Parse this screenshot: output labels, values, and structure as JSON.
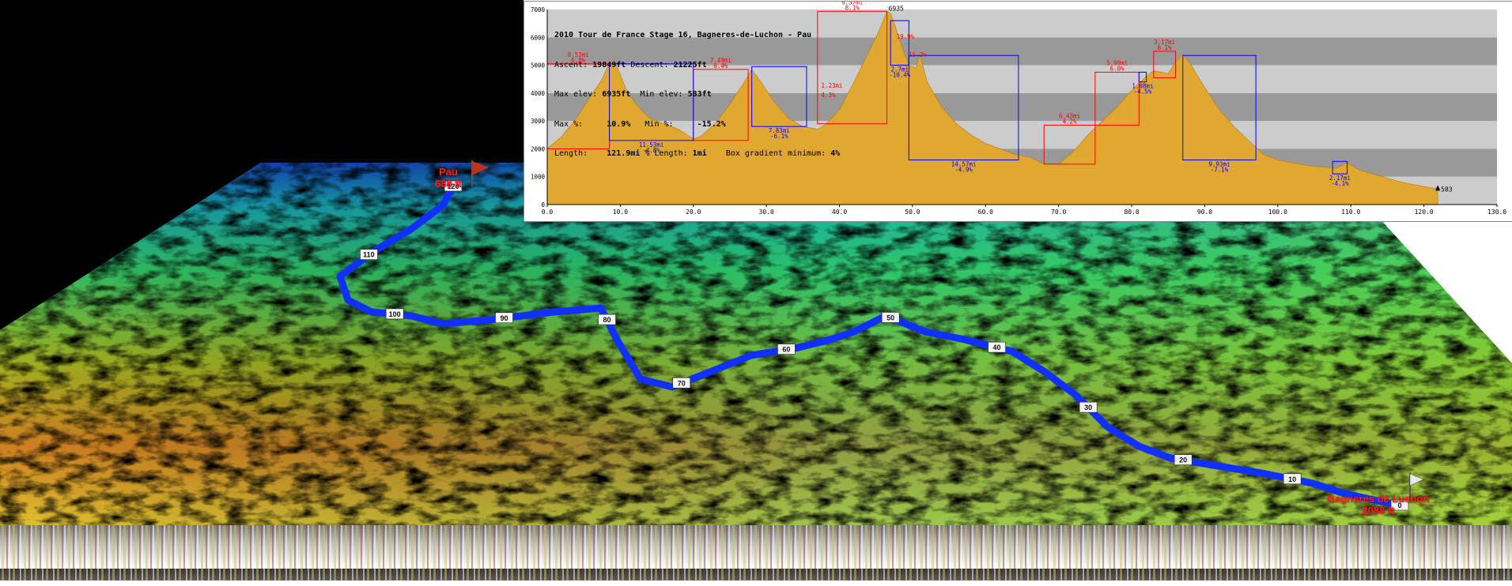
{
  "map": {
    "start": {
      "name": "Pau",
      "elev": "688 ft"
    },
    "finish": {
      "name": "Bagneres de Luchon",
      "elev": "2088 ft"
    },
    "route_markers": [
      "0",
      "10",
      "20",
      "30",
      "40",
      "50",
      "60",
      "70",
      "80",
      "90",
      "100",
      "110",
      "120"
    ]
  },
  "chart_data": {
    "type": "area",
    "title": "2010 Tour de France Stage 16, Bagneres-de-Luchon - Pau",
    "info": {
      "ascent_label": "Ascent:",
      "ascent": "19849ft",
      "descent_label": "Descent:",
      "descent": "21225ft",
      "max_elev_label": "Max elev:",
      "max_elev": "6935ft",
      "min_elev_label": "Min elev:",
      "min_elev": "583ft",
      "max_grad_label": "Max %:",
      "max_grad": "10.9%",
      "min_grad_label": "Min %:",
      "min_grad": "-15.2%",
      "length_label": "Length:",
      "length": "121.9mi",
      "pct_length_label": "% Length:",
      "pct_length": "1mi",
      "box_min_label": "Box gradient minimum:",
      "box_min": "4%"
    },
    "xlim": [
      0,
      130
    ],
    "ylim": [
      0,
      7000
    ],
    "xticks": [
      "0.0",
      "10.0",
      "20.0",
      "30.0",
      "40.0",
      "50.0",
      "60.0",
      "70.0",
      "80.0",
      "90.0",
      "100.0",
      "110.0",
      "120.0",
      "130.0"
    ],
    "yticks": [
      "0",
      "1000",
      "2000",
      "3000",
      "4000",
      "5000",
      "6000",
      "7000"
    ],
    "peak_label": "6935",
    "end_label": "583",
    "colors": {
      "fill": "#e0a830",
      "band_dark": "#999999",
      "band_light": "#cccccc",
      "climb_box": "#ff0000",
      "descent_box": "#0000ff"
    },
    "profile": [
      [
        0,
        2000
      ],
      [
        2,
        2450
      ],
      [
        4,
        3100
      ],
      [
        6,
        3900
      ],
      [
        7.5,
        4500
      ],
      [
        8.5,
        5050
      ],
      [
        9,
        5200
      ],
      [
        9.8,
        4800
      ],
      [
        11,
        4000
      ],
      [
        12.5,
        3500
      ],
      [
        14,
        3100
      ],
      [
        16,
        2900
      ],
      [
        18,
        2700
      ],
      [
        20,
        2350
      ],
      [
        21,
        2450
      ],
      [
        23,
        2900
      ],
      [
        25,
        3600
      ],
      [
        27,
        4400
      ],
      [
        28,
        4850
      ],
      [
        29.5,
        4300
      ],
      [
        31,
        3700
      ],
      [
        33,
        3100
      ],
      [
        35,
        2800
      ],
      [
        37,
        2700
      ],
      [
        38,
        2850
      ],
      [
        40,
        3400
      ],
      [
        42,
        4400
      ],
      [
        43.5,
        5200
      ],
      [
        45,
        6000
      ],
      [
        46,
        6600
      ],
      [
        46.5,
        6935
      ],
      [
        47,
        6850
      ],
      [
        47.5,
        6500
      ],
      [
        48.5,
        5700
      ],
      [
        49.5,
        5000
      ],
      [
        50.5,
        4900
      ],
      [
        51,
        5400
      ],
      [
        52,
        4400
      ],
      [
        54,
        3500
      ],
      [
        56,
        2900
      ],
      [
        58,
        2500
      ],
      [
        60,
        2200
      ],
      [
        62,
        2000
      ],
      [
        64,
        1800
      ],
      [
        66,
        1700
      ],
      [
        68,
        1450
      ],
      [
        70,
        1450
      ],
      [
        72,
        1900
      ],
      [
        74,
        2500
      ],
      [
        76,
        3000
      ],
      [
        78,
        3500
      ],
      [
        80,
        4100
      ],
      [
        82,
        4600
      ],
      [
        83,
        4800
      ],
      [
        85,
        4700
      ],
      [
        86,
        5100
      ],
      [
        87,
        5400
      ],
      [
        88,
        5050
      ],
      [
        90,
        4200
      ],
      [
        92,
        3400
      ],
      [
        94,
        2800
      ],
      [
        96,
        2300
      ],
      [
        98,
        1800
      ],
      [
        100,
        1600
      ],
      [
        102,
        1500
      ],
      [
        104,
        1400
      ],
      [
        106,
        1350
      ],
      [
        108,
        1300
      ],
      [
        109.5,
        1500
      ],
      [
        111,
        1250
      ],
      [
        113,
        1100
      ],
      [
        115,
        950
      ],
      [
        117,
        800
      ],
      [
        119,
        700
      ],
      [
        121,
        600
      ],
      [
        121.9,
        583
      ]
    ],
    "climb_boxes": [
      {
        "x": [
          0,
          8.5
        ],
        "y": [
          2000,
          5050
        ],
        "len": "8.53mi",
        "grad": "6.8%"
      },
      {
        "x": [
          20,
          27.5
        ],
        "y": [
          2300,
          4850
        ],
        "len": "7.49mi",
        "grad": "6.4%"
      },
      {
        "x": [
          37,
          46.5
        ],
        "y": [
          2900,
          6935
        ],
        "len": "9.37mi",
        "grad": "8.1%"
      },
      {
        "x": [
          68,
          75
        ],
        "y": [
          1450,
          2850
        ],
        "len": "6.43mi",
        "grad": "4.2%"
      },
      {
        "x": [
          75,
          81
        ],
        "y": [
          2850,
          4750
        ],
        "len": "5.99mi",
        "grad": "6.0%"
      },
      {
        "x": [
          83,
          86
        ],
        "y": [
          4550,
          5500
        ],
        "len": "3.17mi",
        "grad": "6.1%"
      }
    ],
    "descent_boxes": [
      {
        "x": [
          8.5,
          20
        ],
        "y": [
          2300,
          5050
        ],
        "len": "11.53mi",
        "grad": "-4.8%"
      },
      {
        "x": [
          28,
          35.5
        ],
        "y": [
          2800,
          4950
        ],
        "len": "7.83mi",
        "grad": "-6.1%"
      },
      {
        "x": [
          47,
          49.5
        ],
        "y": [
          5000,
          6600
        ],
        "len": "2.7mi",
        "grad": "-10.4%"
      },
      {
        "x": [
          49.5,
          64.5
        ],
        "y": [
          1600,
          5350
        ],
        "len": "14.57mi",
        "grad": "-4.9%"
      },
      {
        "x": [
          81,
          82
        ],
        "y": [
          4400,
          4750
        ],
        "len": "1.08mi",
        "grad": "-4.5%"
      },
      {
        "x": [
          87,
          97
        ],
        "y": [
          1600,
          5350
        ],
        "len": "9.93mi",
        "grad": "-7.1%"
      },
      {
        "x": [
          107.5,
          109.5
        ],
        "y": [
          1100,
          1550
        ],
        "len": "2.17mi",
        "grad": "-4.1%"
      }
    ],
    "grad_labels": [
      {
        "x": 37.5,
        "y": 4200,
        "text": "1.23mi"
      },
      {
        "x": 37.5,
        "y": 3850,
        "text": "4.3%"
      },
      {
        "x": 49.5,
        "y": 5300,
        "text": "15.2%"
      },
      {
        "x": 47.8,
        "y": 5950,
        "text": "19.9%"
      }
    ]
  }
}
